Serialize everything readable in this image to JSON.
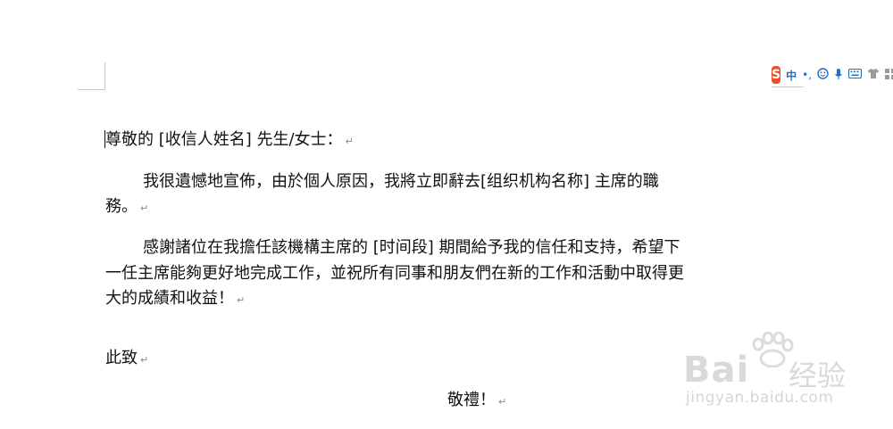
{
  "ime_toolbar": {
    "logo": "S",
    "lang": "中",
    "punct": "•,",
    "icons": [
      "emoji-icon",
      "mic-icon",
      "keyboard-icon",
      "shirt-icon",
      "grid-icon"
    ]
  },
  "letter": {
    "salutation": "尊敬的 [收信人姓名] 先生/女士：",
    "p1_line1": "我很遺憾地宣佈，由於個人原因，我將立即辭去[组织机构名称] 主席的職",
    "p1_line2": "務。",
    "p2_line1": "感謝諸位在我擔任該機構主席的 [时间段] 期間給予我的信任和支持，希望下",
    "p2_line2": "一任主席能夠更好地完成工作，並祝所有同事和朋友們在新的工作和活動中取得更",
    "p2_line3": "大的成績和收益！",
    "closing": "此致",
    "regards": "敬禮！",
    "paragraph_mark": "↵"
  },
  "watermark": {
    "brand": "Bai",
    "brand_cn": "经验",
    "url": "jingyan.baidu.com"
  }
}
